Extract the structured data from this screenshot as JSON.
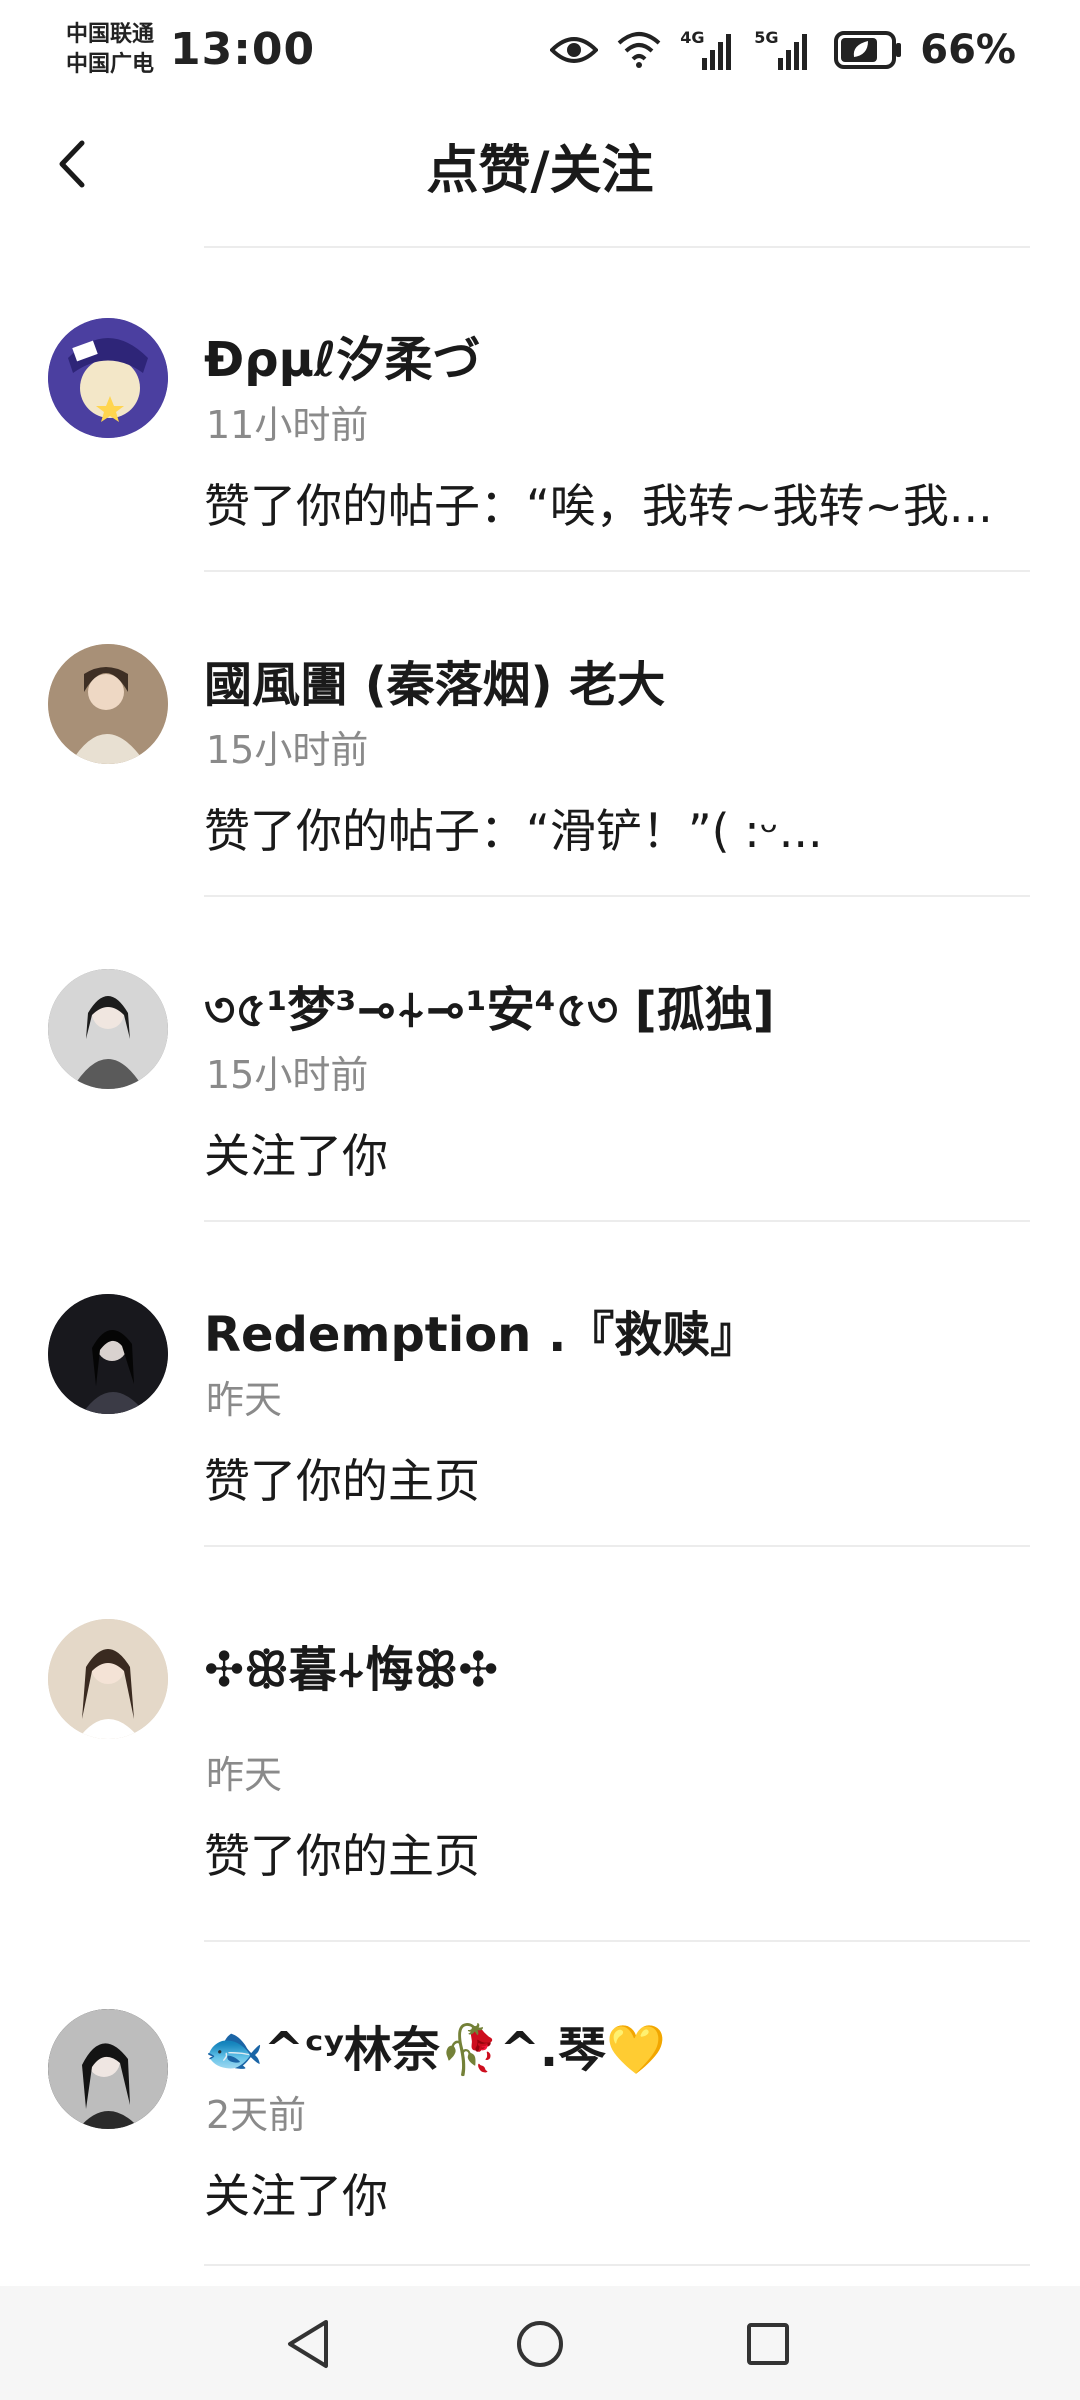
{
  "status_bar": {
    "carrier_1": "中国联通",
    "carrier_2": "中国广电",
    "time": "13:00",
    "network_1": "4G",
    "network_2": "5G",
    "battery": "66%"
  },
  "header": {
    "title": "点赞/关注"
  },
  "notifications": [
    {
      "name": "Đρμℓ汐柔づ",
      "time": "11小时前",
      "action": "赞了你的帖子：“唉，我转~我转~我...",
      "avatar_color": "#4b3fa0"
    },
    {
      "name": "國風圕 (秦落烟) 老大",
      "time": "15小时前",
      "action": "赞了你的帖子：“滑铲！”( :ᵕ...",
      "avatar_color": "#b79f86"
    },
    {
      "name": "৩৫¹梦³⊸⍭⊸¹安⁴৫৩ [孤独]",
      "time": "15小时前",
      "action": "关注了你",
      "avatar_color": "#8e8e8e"
    },
    {
      "name": "Redemption .『救赎』",
      "time": "昨天",
      "action": "赞了你的主页",
      "avatar_color": "#1e1e24"
    },
    {
      "name": "✣ꕥ暮⍭悔ꕥ✣",
      "time": "昨天",
      "action": "赞了你的主页",
      "avatar_color": "#d8c9b6"
    },
    {
      "name": "🐟^ᶜʸ林奈🥀^.琴💛",
      "time": "2天前",
      "action": "关注了你",
      "avatar_color": "#3a3a3a"
    }
  ],
  "colors": {
    "text_primary": "#1a1a1a",
    "text_secondary": "#8a8a8a",
    "divider": "#ececec",
    "nav_bar_bg": "#f6f6f6"
  }
}
